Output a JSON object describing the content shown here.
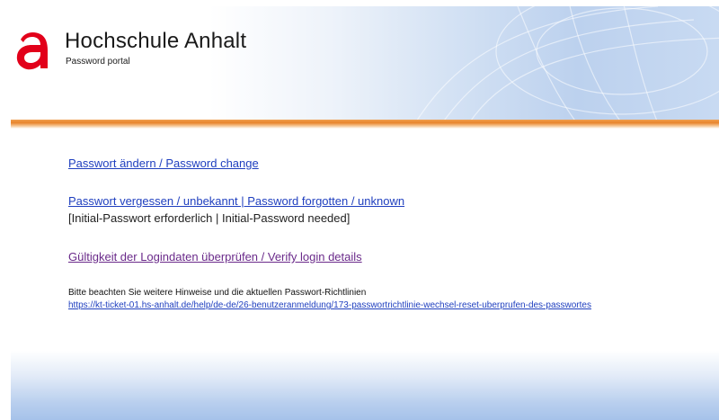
{
  "header": {
    "title": "Hochschule Anhalt",
    "subtitle": "Password portal",
    "logo_icon": "hochschule-anhalt-logo-icon",
    "logo_color": "#e2001a",
    "accent_color": "#e8842c"
  },
  "links": {
    "password_change": "Passwort ändern / Password change",
    "password_forgotten": "Passwort vergessen / unbekannt | Password forgotten / unknown",
    "password_forgotten_note": "[Initial-Passwort erforderlich | Initial-Password needed]",
    "verify_login": "Gültigkeit der Logindaten überprüfen / Verify login details"
  },
  "hint": {
    "text": "Bitte beachten Sie weitere Hinweise und die aktuellen Passwort-Richtlinien",
    "url": "https://kt-ticket-01.hs-anhalt.de/help/de-de/26-benutzeranmeldung/173-passwortrichtlinie-wechsel-reset-uberprufen-des-passwortes"
  }
}
